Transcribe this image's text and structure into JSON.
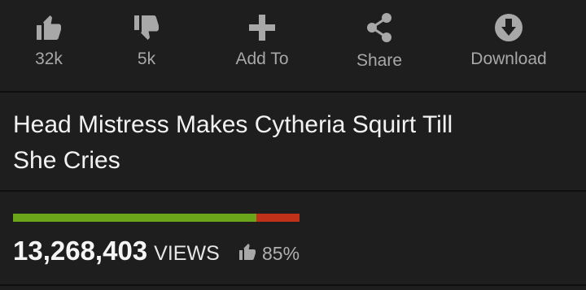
{
  "actions": {
    "like": {
      "label": "32k",
      "icon": "thumbs-up-icon"
    },
    "dislike": {
      "label": "5k",
      "icon": "thumbs-down-icon"
    },
    "add_to": {
      "label": "Add To",
      "icon": "plus-icon"
    },
    "share": {
      "label": "Share",
      "icon": "share-icon"
    },
    "download": {
      "label": "Download",
      "icon": "download-icon"
    }
  },
  "video": {
    "title": "Head Mistress Makes Cytheria Squirt Till She Cries",
    "views_count": "13,268,403",
    "views_label": "VIEWS",
    "rating_percent": "85%",
    "rating_fraction": 0.85
  },
  "colors": {
    "background": "#1e1e1e",
    "positive": "#6aa51a",
    "negative": "#c0311a",
    "icon": "#a8a8a8"
  }
}
